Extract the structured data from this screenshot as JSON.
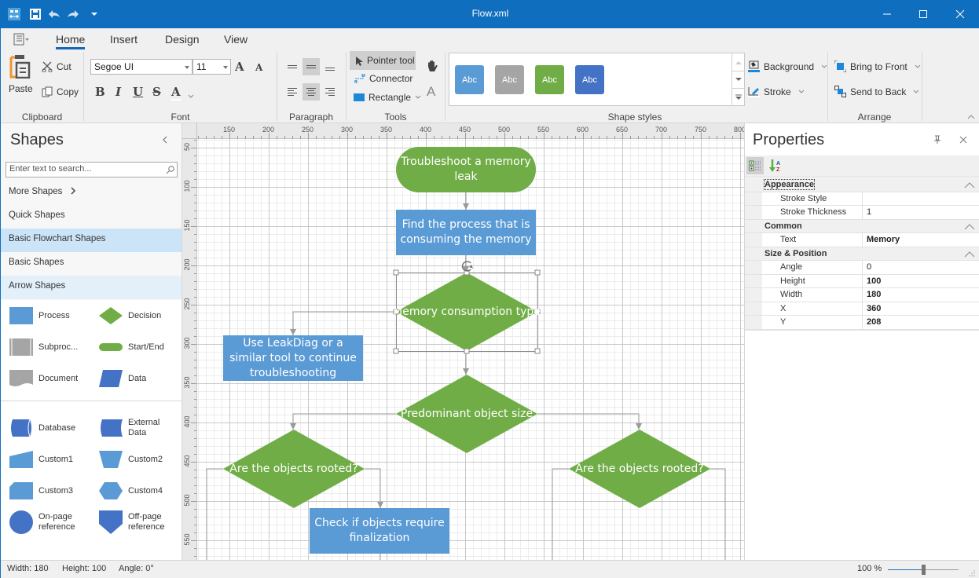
{
  "window": {
    "title": "Flow.xml",
    "qat": [
      "app-icon",
      "save-icon",
      "undo-icon",
      "redo-icon",
      "customize-qat-icon"
    ],
    "controls": [
      "minimize",
      "maximize",
      "close"
    ]
  },
  "ribbon": {
    "tabs": [
      {
        "label": "Home",
        "active": true
      },
      {
        "label": "Insert",
        "active": false
      },
      {
        "label": "Design",
        "active": false
      },
      {
        "label": "View",
        "active": false
      }
    ],
    "clipboard": {
      "label": "Clipboard",
      "paste": "Paste",
      "cut": "Cut",
      "copy": "Copy"
    },
    "font": {
      "label": "Font",
      "family": "Segoe UI",
      "size": "11",
      "bold": "B",
      "italic": "I",
      "underline": "U",
      "strike": "S",
      "color": "A",
      "grow": "A",
      "shrink": "A"
    },
    "paragraph": {
      "label": "Paragraph"
    },
    "tools": {
      "label": "Tools",
      "pointer": "Pointer tool",
      "connector": "Connector",
      "rectangle": "Rectangle",
      "text_glyph": "A"
    },
    "shape_styles": {
      "label": "Shape styles",
      "swatches": [
        {
          "text": "Abc",
          "color": "#5B9BD5"
        },
        {
          "text": "Abc",
          "color": "#A5A5A5"
        },
        {
          "text": "Abc",
          "color": "#70AD47"
        },
        {
          "text": "Abc",
          "color": "#4472C4"
        }
      ],
      "background": "Background",
      "stroke": "Stroke"
    },
    "arrange": {
      "label": "Arrange",
      "bring_front": "Bring to Front",
      "send_back": "Send to Back"
    }
  },
  "shapes_panel": {
    "title": "Shapes",
    "search_placeholder": "Enter text to search...",
    "categories": [
      {
        "label": "More Shapes",
        "state": "normal"
      },
      {
        "label": "Quick Shapes",
        "state": "normal"
      },
      {
        "label": "Basic Flowchart Shapes",
        "state": "selected"
      },
      {
        "label": "Basic Shapes",
        "state": "normal"
      },
      {
        "label": "Arrow Shapes",
        "state": "hover"
      }
    ],
    "shapes": [
      {
        "label": "Process",
        "icon": "process"
      },
      {
        "label": "Decision",
        "icon": "decision"
      },
      {
        "label": "Subproc...",
        "icon": "subprocess"
      },
      {
        "label": "Start/End",
        "icon": "startend"
      },
      {
        "label": "Document",
        "icon": "document"
      },
      {
        "label": "Data",
        "icon": "data"
      },
      {
        "label": "Database",
        "icon": "database"
      },
      {
        "label": "External Data",
        "icon": "external-data"
      },
      {
        "label": "Custom1",
        "icon": "custom1"
      },
      {
        "label": "Custom2",
        "icon": "custom2"
      },
      {
        "label": "Custom3",
        "icon": "custom3"
      },
      {
        "label": "Custom4",
        "icon": "custom4"
      },
      {
        "label": "On-page reference",
        "icon": "on-page-ref"
      },
      {
        "label": "Off-page reference",
        "icon": "off-page-ref"
      }
    ]
  },
  "rulers": {
    "horizontal": [
      "150",
      "200",
      "250",
      "300",
      "350",
      "400",
      "450",
      "500",
      "550",
      "600",
      "650",
      "700",
      "750",
      "800"
    ],
    "vertical": [
      "50",
      "100",
      "150",
      "200",
      "250",
      "300",
      "350",
      "400",
      "450",
      "500",
      "550"
    ]
  },
  "diagram": {
    "colors": {
      "decision": "#70AD47",
      "process": "#5B9BD5",
      "connector": "#9a9a9a"
    },
    "nodes": [
      {
        "id": "n1",
        "type": "startend",
        "text": "Troubleshoot a memory leak"
      },
      {
        "id": "n2",
        "type": "process",
        "text": "Find the process that is consuming the memory"
      },
      {
        "id": "n3",
        "type": "decision",
        "text": "Memory consumption type",
        "selected": true
      },
      {
        "id": "n4",
        "type": "process",
        "text": "Use LeakDiag or a similar tool to continue troubleshooting"
      },
      {
        "id": "n5",
        "type": "decision",
        "text": "Predominant object size"
      },
      {
        "id": "n6",
        "type": "decision",
        "text": "Are the objects rooted?"
      },
      {
        "id": "n7",
        "type": "decision",
        "text": "Are the objects rooted?"
      },
      {
        "id": "n8",
        "type": "process",
        "text": "Check if objects require finalization"
      }
    ]
  },
  "properties": {
    "title": "Properties",
    "categories": [
      {
        "name": "Appearance",
        "rows": [
          {
            "name": "Stroke Style",
            "value": "",
            "bold": false
          },
          {
            "name": "Stroke Thickness",
            "value": "1",
            "bold": false
          }
        ]
      },
      {
        "name": "Common",
        "rows": [
          {
            "name": "Text",
            "value": "Memory",
            "bold": true
          }
        ]
      },
      {
        "name": "Size & Position",
        "rows": [
          {
            "name": "Angle",
            "value": "0",
            "bold": false
          },
          {
            "name": "Height",
            "value": "100",
            "bold": true
          },
          {
            "name": "Width",
            "value": "180",
            "bold": true
          },
          {
            "name": "X",
            "value": "360",
            "bold": true
          },
          {
            "name": "Y",
            "value": "208",
            "bold": true
          }
        ]
      }
    ]
  },
  "status": {
    "width": "Width: 180",
    "height": "Height: 100",
    "angle": "Angle: 0°",
    "zoom": "100 %",
    "zoom_level": 0.5
  }
}
